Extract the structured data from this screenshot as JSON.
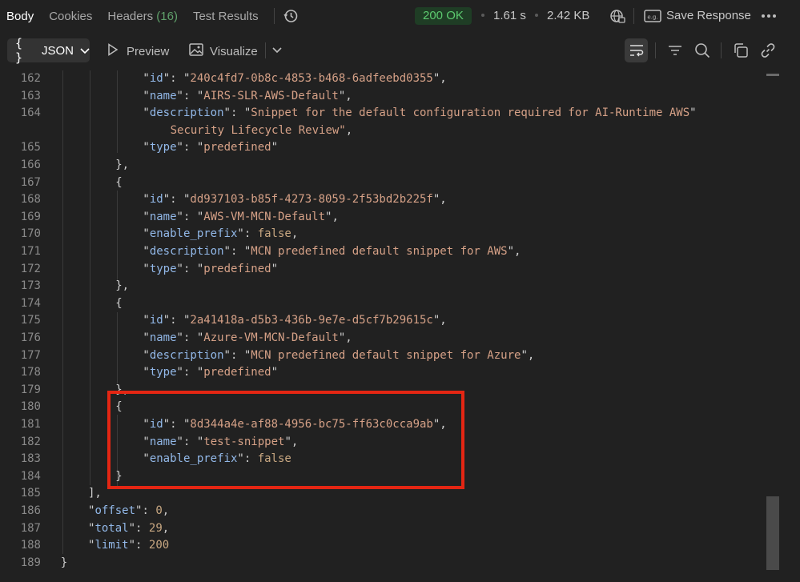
{
  "tabs": [
    {
      "label": "Body"
    },
    {
      "label": "Cookies"
    },
    {
      "label": "Headers",
      "count": "(16)"
    },
    {
      "label": "Test Results"
    }
  ],
  "status": {
    "code": "200 OK",
    "time": "1.61 s",
    "size": "2.42 KB"
  },
  "save_response_label": "Save Response",
  "toolbar": {
    "format": "JSON",
    "preview": "Preview",
    "visualize": "Visualize"
  },
  "code_lines": [
    {
      "num": "162",
      "indent": 2,
      "key": "id",
      "str": "240c4fd7-0b8c-4853-b468-6adfeebd0355",
      "tail": ","
    },
    {
      "num": "163",
      "indent": 2,
      "key": "name",
      "str": "AIRS-SLR-AWS-Default",
      "tail": ","
    },
    {
      "num": "164",
      "indent": 2,
      "key": "description",
      "str": "Snippet for the default configuration required for AI-Runtime AWS"
    },
    {
      "num": "",
      "indent": 3,
      "cont": "Security Lifecycle Review\"",
      "tail": ","
    },
    {
      "num": "165",
      "indent": 2,
      "key": "type",
      "str": "predefined"
    },
    {
      "num": "166",
      "indent": 1,
      "text": "},"
    },
    {
      "num": "167",
      "indent": 1,
      "text": "{"
    },
    {
      "num": "168",
      "indent": 2,
      "key": "id",
      "str": "dd937103-b85f-4273-8059-2f53bd2b225f",
      "tail": ","
    },
    {
      "num": "169",
      "indent": 2,
      "key": "name",
      "str": "AWS-VM-MCN-Default",
      "tail": ","
    },
    {
      "num": "170",
      "indent": 2,
      "key": "enable_prefix",
      "val": "false",
      "tail": ","
    },
    {
      "num": "171",
      "indent": 2,
      "key": "description",
      "str": "MCN predefined default snippet for AWS",
      "tail": ","
    },
    {
      "num": "172",
      "indent": 2,
      "key": "type",
      "str": "predefined"
    },
    {
      "num": "173",
      "indent": 1,
      "text": "},"
    },
    {
      "num": "174",
      "indent": 1,
      "text": "{"
    },
    {
      "num": "175",
      "indent": 2,
      "key": "id",
      "str": "2a41418a-d5b3-436b-9e7e-d5cf7b29615c",
      "tail": ","
    },
    {
      "num": "176",
      "indent": 2,
      "key": "name",
      "str": "Azure-VM-MCN-Default",
      "tail": ","
    },
    {
      "num": "177",
      "indent": 2,
      "key": "description",
      "str": "MCN predefined default snippet for Azure",
      "tail": ","
    },
    {
      "num": "178",
      "indent": 2,
      "key": "type",
      "str": "predefined"
    },
    {
      "num": "179",
      "indent": 1,
      "text": "},"
    },
    {
      "num": "180",
      "indent": 1,
      "text": "{"
    },
    {
      "num": "181",
      "indent": 2,
      "key": "id",
      "str": "8d344a4e-af88-4956-bc75-ff63c0cca9ab",
      "tail": ","
    },
    {
      "num": "182",
      "indent": 2,
      "key": "name",
      "str": "test-snippet",
      "tail": ","
    },
    {
      "num": "183",
      "indent": 2,
      "key": "enable_prefix",
      "val": "false"
    },
    {
      "num": "184",
      "indent": 1,
      "text": "}"
    },
    {
      "num": "185",
      "indent": 0,
      "text": "],"
    },
    {
      "num": "186",
      "indent": 0,
      "key": "offset",
      "val": "0",
      "tail": ","
    },
    {
      "num": "187",
      "indent": 0,
      "key": "total",
      "val": "29",
      "tail": ","
    },
    {
      "num": "188",
      "indent": 0,
      "key": "limit",
      "val": "200"
    },
    {
      "num": "189",
      "indent": -1,
      "text": "}"
    }
  ]
}
